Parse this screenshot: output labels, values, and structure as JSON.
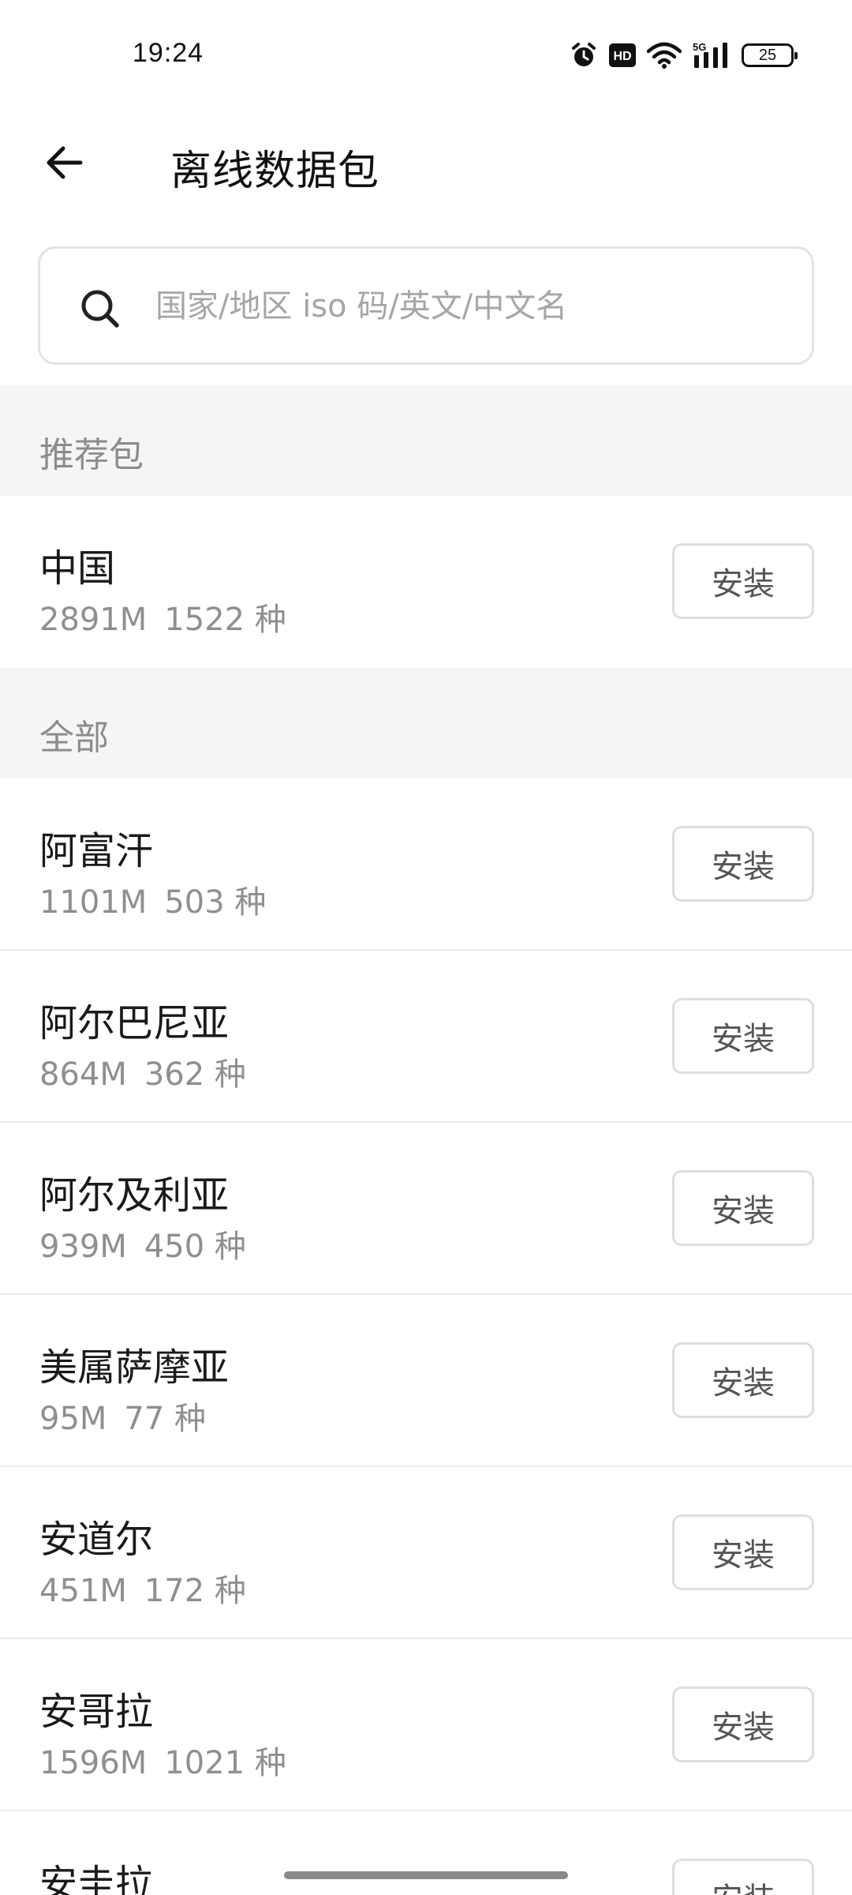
{
  "status_bar": {
    "time": "19:24",
    "icons": [
      "alarm-icon",
      "hd-icon",
      "wifi-icon",
      "5g-signal-icon",
      "battery-icon"
    ],
    "network_label": "5G",
    "hd_label": "HD",
    "battery_level": "25"
  },
  "header": {
    "back_icon": "arrow-left-icon",
    "title": "离线数据包"
  },
  "search": {
    "icon": "search-icon",
    "placeholder": "国家/地区 iso 码/英文/中文名",
    "value": ""
  },
  "sections": {
    "recommended": {
      "label": "推荐包",
      "items": [
        {
          "name": "中国",
          "size": "2891M",
          "count": "1522 种",
          "action": "安装"
        }
      ]
    },
    "all": {
      "label": "全部",
      "items": [
        {
          "name": "阿富汗",
          "size": "1101M",
          "count": "503 种",
          "action": "安装"
        },
        {
          "name": "阿尔巴尼亚",
          "size": "864M",
          "count": "362 种",
          "action": "安装"
        },
        {
          "name": "阿尔及利亚",
          "size": "939M",
          "count": "450 种",
          "action": "安装"
        },
        {
          "name": "美属萨摩亚",
          "size": "95M",
          "count": "77 种",
          "action": "安装"
        },
        {
          "name": "安道尔",
          "size": "451M",
          "count": "172 种",
          "action": "安装"
        },
        {
          "name": "安哥拉",
          "size": "1596M",
          "count": "1021 种",
          "action": "安装"
        },
        {
          "name": "安圭拉",
          "size": "",
          "count": "",
          "action": "安装"
        }
      ]
    }
  },
  "colors": {
    "background": "#ffffff",
    "section_background": "#f5f5f5",
    "primary_text": "#1a1a1a",
    "secondary_text": "#8f8f8f",
    "button_border": "#dedede"
  }
}
